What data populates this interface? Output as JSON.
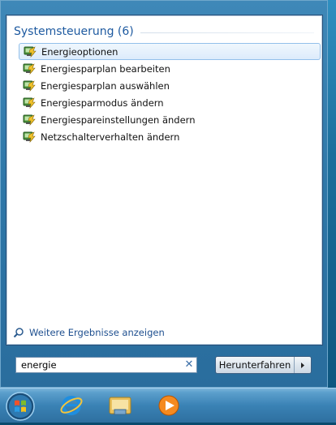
{
  "group": {
    "title": "Systemsteuerung (6)"
  },
  "results": [
    {
      "label": "Energieoptionen",
      "icon": "power-options-icon",
      "selected": true
    },
    {
      "label": "Energiesparplan bearbeiten",
      "icon": "power-options-icon"
    },
    {
      "label": "Energiesparplan auswählen",
      "icon": "power-options-icon"
    },
    {
      "label": "Energiesparmodus ändern",
      "icon": "power-options-icon"
    },
    {
      "label": "Energiespareinstellungen ändern",
      "icon": "power-options-icon"
    },
    {
      "label": "Netzschalterverhalten ändern",
      "icon": "power-options-icon"
    }
  ],
  "more_results": {
    "label": "Weitere Ergebnisse anzeigen",
    "icon": "magnifier-icon"
  },
  "search": {
    "value": "energie",
    "clear_icon": "close-icon"
  },
  "shutdown": {
    "label": "Herunterfahren",
    "arrow_icon": "chevron-right-icon"
  },
  "taskbar": {
    "items": [
      "start-orb-icon",
      "internet-explorer-icon",
      "windows-explorer-icon",
      "media-player-icon"
    ]
  },
  "colors": {
    "header_text": "#1e5aa0",
    "selection_border": "#93c0ea",
    "link_text": "#1e4f8f"
  }
}
